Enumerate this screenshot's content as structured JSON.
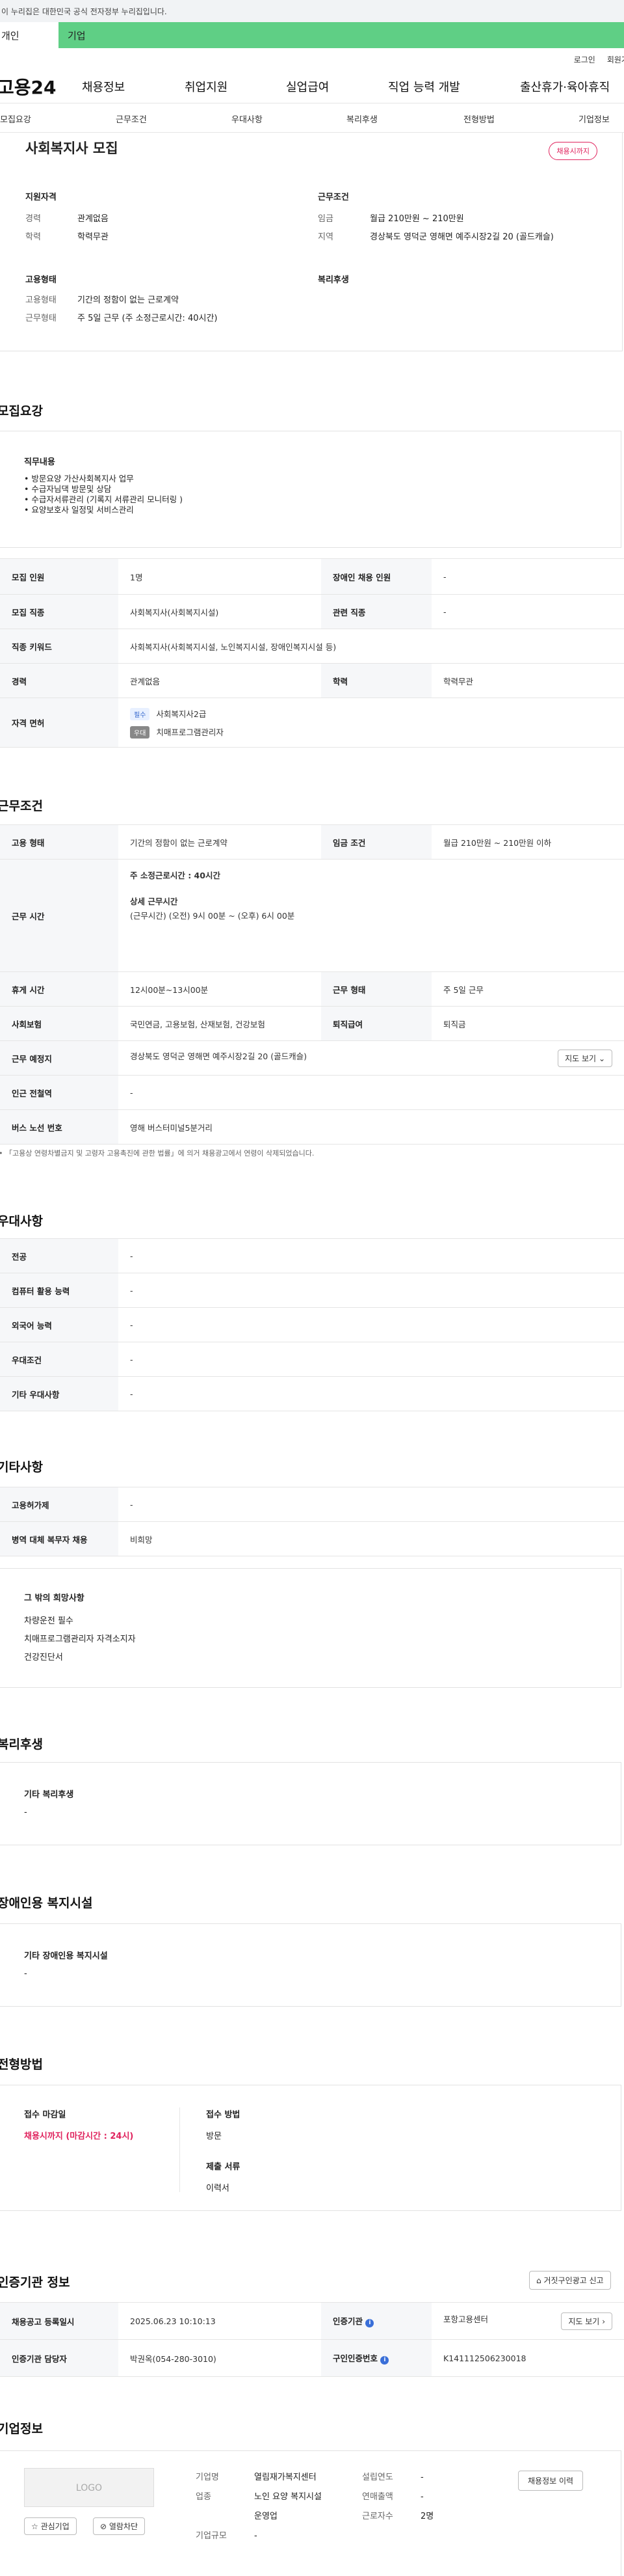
{
  "gov_banner": "이 누리집은 대한민국 공식 전자정부 누리집입니다.",
  "top_tabs": {
    "person": "개인",
    "company": "기업"
  },
  "util": {
    "login": "로그인",
    "join": "회원가입"
  },
  "logo": "고용24",
  "gnb": [
    "채용정보",
    "취업지원",
    "실업급여",
    "직업 능력 개발",
    "출산휴가·육아휴직"
  ],
  "subnav": [
    "모집요강",
    "근무조건",
    "우대사항",
    "복리후생",
    "전형방법",
    "기업정보"
  ],
  "summary": {
    "title": "사회복지사 모집",
    "badge": "채용시까지",
    "h_req": "지원자격",
    "career_k": "경력",
    "career_v": "관계없음",
    "edu_k": "학력",
    "edu_v": "학력무관",
    "h_work": "근무조건",
    "wage_k": "임금",
    "wage_v": "월급 210만원 ~ 210만원",
    "loc_k": "지역",
    "loc_v": "경상북도 영덕군 영해면 예주시장2길 20 (골드캐슬)",
    "h_emp": "고용형태",
    "emp_k": "고용형태",
    "emp_v": "기간의 정함이 없는 근로계약",
    "wt_k": "근무형태",
    "wt_v": "주 5일 근무 (주 소정근로시간: 40시간)",
    "h_welfare": "복리후생"
  },
  "recruit": {
    "title": "모집요강",
    "duty_h": "직무내용",
    "duties": [
      "• 방문요양  가산사회복지사 업무",
      "• 수급자님댁 방문및 상담",
      "• 수급자서류관리 (기록지 서류관리 모니터링 )",
      "• 요양보호사 일정및 서비스관리"
    ],
    "rows": {
      "r1k": "모집 인원",
      "r1v": "1명",
      "r1k2": "장애인 채용 인원",
      "r1v2": "-",
      "r2k": "모집 직종",
      "r2v": "사회복지사(사회복지시설)",
      "r2k2": "관련 직종",
      "r2v2": "-",
      "r3k": "직종 키워드",
      "r3v": "사회복지사(사회복지시설, 노인복지시설, 장애인복지시설 등)",
      "r4k": "경력",
      "r4v": "관계없음",
      "r4k2": "학력",
      "r4v2": "학력무관",
      "r5k": "자격 면허",
      "lic1_tag": "필수",
      "lic1": "사회복지사2급",
      "lic2_tag": "우대",
      "lic2": "치매프로그램관리자"
    }
  },
  "work": {
    "title": "근무조건",
    "empk": "고용 형태",
    "empv": "기간의 정함이 없는 근로계약",
    "wagek": "임금 조건",
    "wagev": "월급 210만원 ~ 210만원 이하",
    "timek": "근무 시간",
    "time1": "주 소정근로시간 : 40시간",
    "time2": "상세 근무시간",
    "time3": "(근무시간) (오전) 9시 00분 ~ (오후) 6시 00분",
    "restk": "휴게 시간",
    "restv": "12시00분~13시00분",
    "typek": "근무 형태",
    "typev": "주 5일 근무",
    "insk": "사회보험",
    "insv": "국민연금, 고용보험, 산재보험, 건강보험",
    "retk": "퇴직급여",
    "retv": "퇴직금",
    "placek": "근무 예정지",
    "placev": "경상북도 영덕군 영해면 예주시장2길 20 (골드캐슬)",
    "map_btn": "지도 보기",
    "stationk": "인근 전철역",
    "stationv": "-",
    "busk": "버스 노선 번호",
    "busv": "영해 버스터미널5분거리",
    "note": "「고용상 연령차별금지 및 고령자 고용촉진에 관한 법률」에 의거 채용광고에서 연령이 삭제되었습니다."
  },
  "pref": {
    "title": "우대사항",
    "r": [
      [
        "전공",
        "-"
      ],
      [
        "컴퓨터 활용 능력",
        "-"
      ],
      [
        "외국어 능력",
        "-"
      ],
      [
        "우대조건",
        "-"
      ],
      [
        "기타 우대사항",
        "-"
      ]
    ]
  },
  "etc": {
    "title": "기타사항",
    "r1k": "고용허가제",
    "r1v": "-",
    "r2k": "병역 대체 복무자 채용",
    "r2v": "비희망",
    "hope_h": "그 밖의 희망사항",
    "hope": [
      "차량운전 필수",
      "치매프로그램관리자 자격소지자",
      "건강진단서"
    ]
  },
  "welfare": {
    "title": "복리후생",
    "h": "기타 복리후생",
    "v": "-"
  },
  "disab": {
    "title": "장애인용 복지시설",
    "h": "기타 장애인용 복지시설",
    "v": "-"
  },
  "process": {
    "title": "전형방법",
    "deadline_h": "접수 마감일",
    "deadline_v": "채용시까지 (마감시간 : 24시)",
    "method_h": "접수 방법",
    "method_v": "방문",
    "docs_h": "제출 서류",
    "docs_v": "이력서"
  },
  "cert": {
    "title": "인증기관 정보",
    "report_btn": "거짓구인광고 신고",
    "r1k": "채용공고 등록일시",
    "r1v": "2025.06.23 10:10:13",
    "r1k2": "인증기관",
    "r1v2": "포항고용센터",
    "map_btn": "지도 보기",
    "r2k": "인증기관 담당자",
    "r2v": "박권옥(054-280-3010)",
    "r2k2": "구인인증번호",
    "r2v2": "K141112506230018"
  },
  "company": {
    "title": "기업정보",
    "logo": "LOGO",
    "fav": "관심기업",
    "block": "열람차단",
    "name_k": "기업명",
    "name_v": "열림재가복지센터",
    "field_k": "업종",
    "field_v": "노인 요양 복지시설 운영업",
    "size_k": "기업규모",
    "size_v": "-",
    "est_k": "설립연도",
    "est_v": "-",
    "sales_k": "연매출액",
    "sales_v": "-",
    "emp_k": "근로자수",
    "emp_v": "2명",
    "hist_btn": "채용정보 이력"
  }
}
